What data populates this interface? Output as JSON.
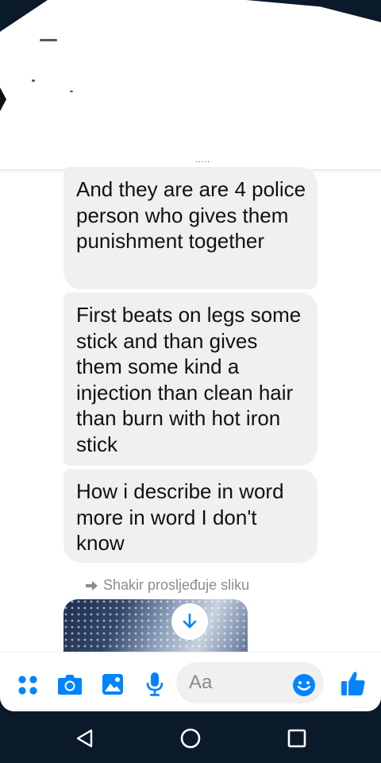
{
  "messages": [
    {
      "text": "And they are are 4 police person who gives them punishment  together"
    },
    {
      "text": "First beats on legs some stick and than gives them some kind a injection  than clean hair than burn with hot iron stick"
    },
    {
      "text": "How i describe in word more in word I don't know"
    }
  ],
  "forward_notice": "Shakir prosljeđuje sliku",
  "composer": {
    "placeholder": "Aa",
    "icons": [
      "more-apps-icon",
      "camera-icon",
      "gallery-icon",
      "microphone-icon",
      "emoji-icon",
      "thumbs-up-icon"
    ]
  },
  "nav": {
    "icons": [
      "back-icon",
      "home-icon",
      "recents-icon"
    ]
  },
  "colors": {
    "bubble_bg": "#f1f0f0",
    "messenger_blue": "#0084ff",
    "nav_bar": "#0b1a2a",
    "muted_text": "#8c8c8c"
  }
}
